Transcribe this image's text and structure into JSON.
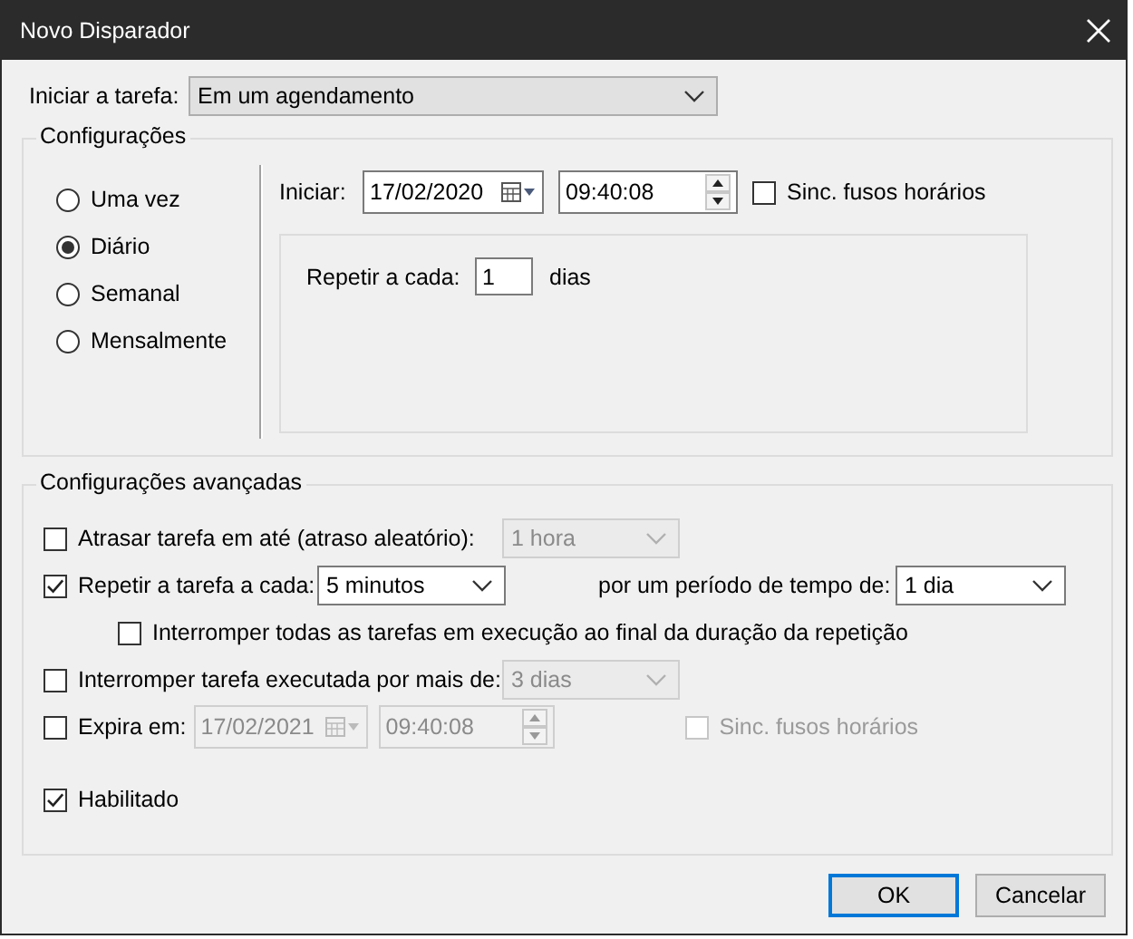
{
  "window": {
    "title": "Novo Disparador"
  },
  "start_task": {
    "label": "Iniciar a tarefa:",
    "value": "Em um agendamento"
  },
  "settings": {
    "title": "Configurações",
    "schedules": [
      {
        "label": "Uma vez",
        "selected": false
      },
      {
        "label": "Diário",
        "selected": true
      },
      {
        "label": "Semanal",
        "selected": false
      },
      {
        "label": "Mensalmente",
        "selected": false
      }
    ],
    "start": {
      "label": "Iniciar:",
      "date": "17/02/2020",
      "time": "09:40:08",
      "sync_label": "Sinc. fusos horários",
      "sync_checked": false
    },
    "repeat": {
      "label": "Repetir a cada:",
      "value": "1",
      "unit": "dias"
    }
  },
  "advanced": {
    "title": "Configurações avançadas",
    "options": [
      {
        "kind": "combo",
        "label": "Atrasar tarefa em até (atraso aleatório):",
        "checked": false,
        "value": "1 hora",
        "disabled": true
      },
      {
        "kind": "repeat",
        "label": "Repetir a tarefa a cada:",
        "checked": true,
        "value": "5 minutos",
        "duration_label": "por um período de tempo de:",
        "duration": "1 dia"
      },
      {
        "kind": "sub",
        "label": "Interromper todas as tarefas em execução ao final da duração da repetição",
        "checked": false
      },
      {
        "kind": "combo",
        "label": "Interromper tarefa executada por mais de:",
        "checked": false,
        "value": "3 dias",
        "disabled": true
      },
      {
        "kind": "expiry",
        "label": "Expira em:",
        "checked": false,
        "date": "17/02/2021",
        "time": "09:40:08",
        "sync_label": "Sinc. fusos horários",
        "sync_checked": false,
        "disabled": true
      },
      {
        "kind": "check",
        "label": "Habilitado",
        "checked": true
      }
    ]
  },
  "buttons": [
    {
      "label": "OK",
      "default": true
    },
    {
      "label": "Cancelar",
      "default": false
    }
  ]
}
